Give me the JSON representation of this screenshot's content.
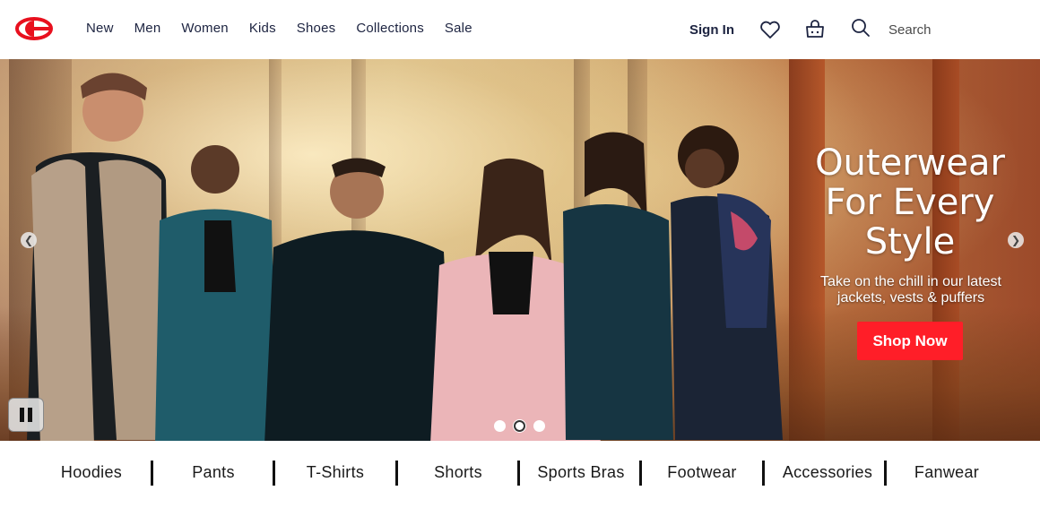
{
  "header": {
    "logo": "champion-c-logo",
    "nav": [
      "New",
      "Men",
      "Women",
      "Kids",
      "Shoes",
      "Collections",
      "Sale"
    ],
    "sign_in": "Sign In",
    "icons": [
      "heart-icon",
      "cart-icon",
      "search-icon"
    ],
    "search_label": "Search"
  },
  "hero": {
    "title_lines": [
      "Outerwear",
      "For Every",
      "Style"
    ],
    "subtitle_lines": [
      "Take on the chill in our latest",
      "jackets, vests & puffers"
    ],
    "cta": "Shop Now",
    "slide_count": 3,
    "active_slide": 2
  },
  "categories": [
    "Hoodies",
    "Pants",
    "T-Shirts",
    "Shorts",
    "Sports Bras",
    "Footwear",
    "Accessories",
    "Fanwear"
  ],
  "colors": {
    "brand_red": "#ff1e28",
    "nav_text": "#1c2340"
  }
}
